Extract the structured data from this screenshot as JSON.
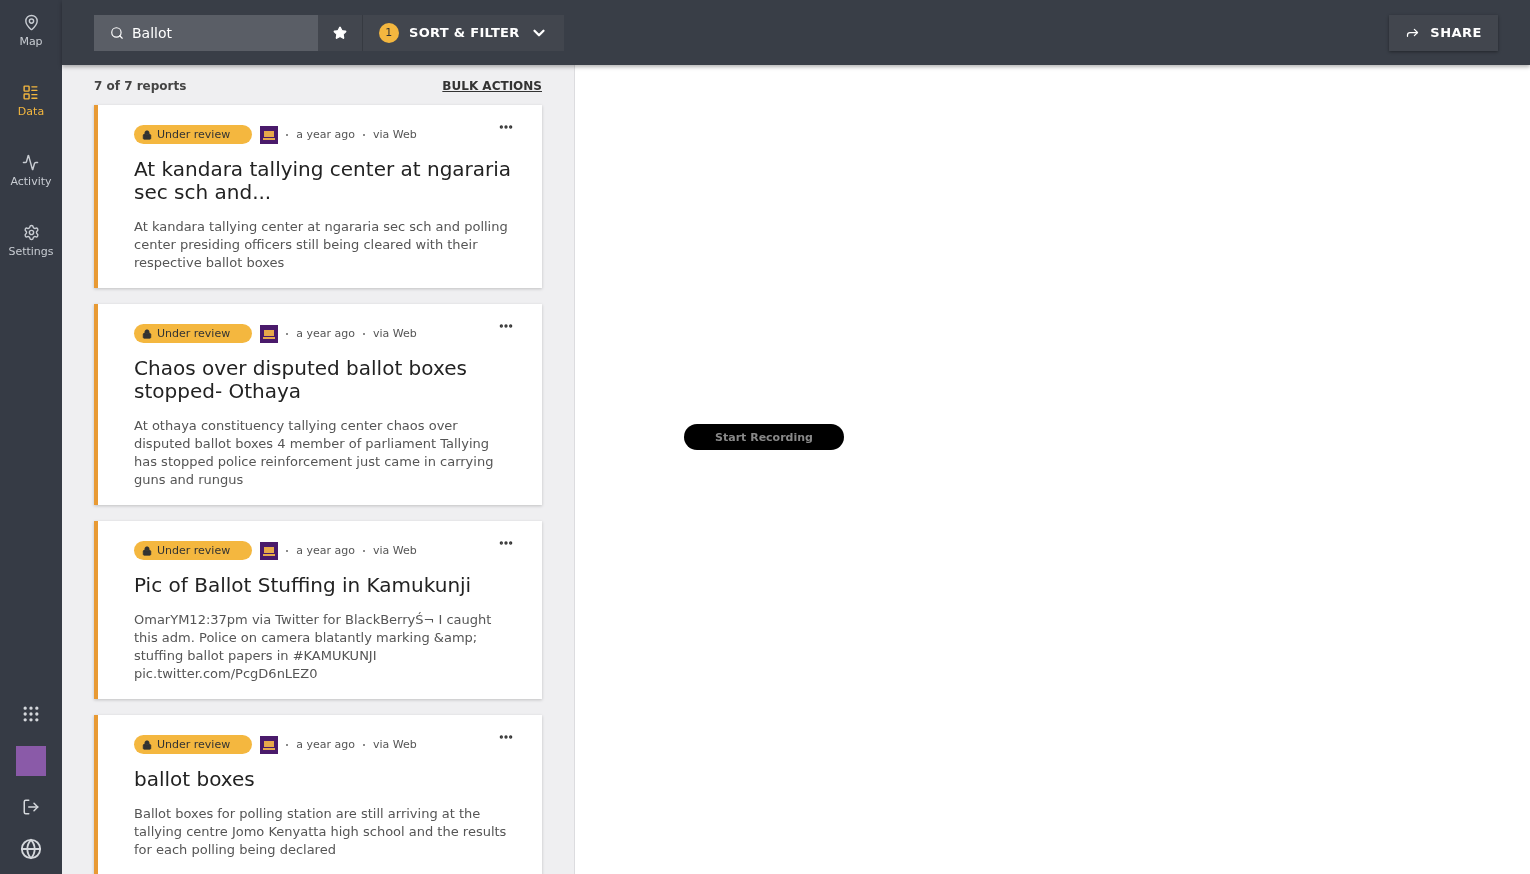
{
  "sidebar": {
    "items": [
      {
        "kind": "map",
        "label": "Map",
        "selected": false
      },
      {
        "kind": "data",
        "label": "Data",
        "selected": true
      },
      {
        "kind": "activity",
        "label": "Activity",
        "selected": false
      },
      {
        "kind": "settings",
        "label": "Settings",
        "selected": false
      }
    ]
  },
  "toolbar": {
    "search": {
      "value": "Ballot"
    },
    "filter_count": "1",
    "filter_label": "SORT & FILTER",
    "share_label": "SHARE"
  },
  "list": {
    "count": "7 of 7 reports",
    "bulk_actions": "BULK ACTIONS",
    "posts": [
      {
        "status": "Under review",
        "time": "a year ago",
        "source": "via Web",
        "title": "At kandara tallying center at ngararia sec sch and...",
        "body": "At kandara tallying center at ngararia sec sch and polling center presiding officers still being cleared with their respective ballot boxes"
      },
      {
        "status": "Under review",
        "time": "a year ago",
        "source": "via Web",
        "title": "Chaos over disputed ballot boxes stopped- Othaya",
        "body": "At othaya constituency tallying center chaos over disputed ballot boxes 4 member of parliament Tallying has stopped police reinforcement just came in carrying guns and rungus"
      },
      {
        "status": "Under review",
        "time": "a year ago",
        "source": "via Web",
        "title": "Pic of Ballot Stuffing in Kamukunji",
        "body": "OmarYM12:37pm via Twitter for BlackBerryŚ¬ I caught this adm. Police on camera blatantly marking &amp; stuffing ballot papers in #KAMUKUNJI pic.twitter.com/PcgD6nLEZ0"
      },
      {
        "status": "Under review",
        "time": "a year ago",
        "source": "via Web",
        "title": "ballot boxes",
        "body": "Ballot boxes for polling station are still arriving at the tallying centre Jomo Kenyatta high school and the results for each polling being declared"
      }
    ]
  },
  "recorder": {
    "label": "Start Recording"
  }
}
